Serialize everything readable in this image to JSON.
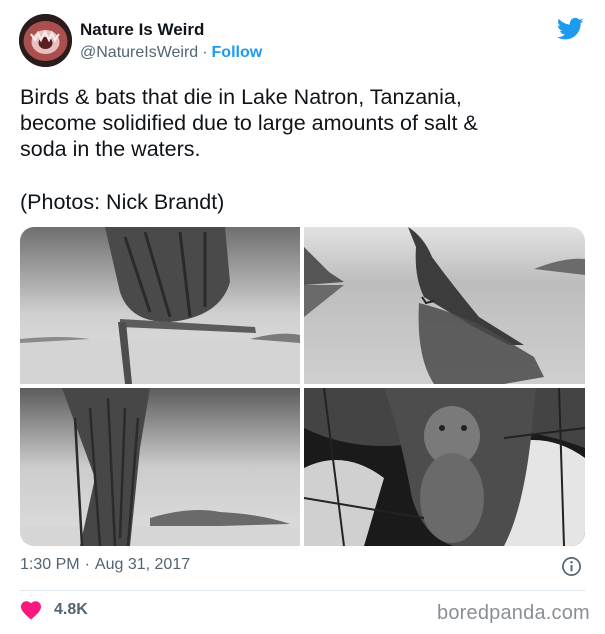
{
  "tweet": {
    "display_name": "Nature Is Weird",
    "handle": "@NatureIsWeird",
    "separator": "·",
    "follow_label": "Follow",
    "text": "Birds & bats that die in Lake Natron, Tanzania,\nbecome solidified due to large amounts of salt &\nsoda in the waters.",
    "credit": "(Photos: Nick Brandt)",
    "time": "1:30 PM",
    "date": "Aug 31, 2017",
    "likes": "4.8K"
  },
  "icons": {
    "brand": "twitter-bird-icon",
    "info": "info-icon",
    "like": "heart-icon"
  },
  "colors": {
    "accent": "#1d9bf0",
    "like": "#f91880",
    "secondary_text": "#536471"
  },
  "watermark": "boredpanda.com"
}
